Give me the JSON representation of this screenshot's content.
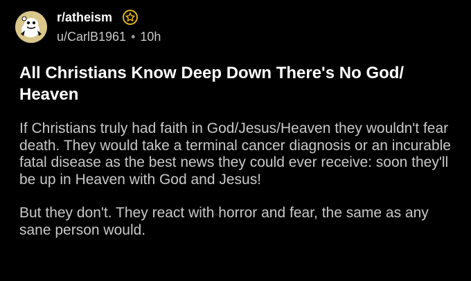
{
  "post": {
    "subreddit": "r/atheism",
    "author": "u/CarlB1961",
    "separator": "•",
    "time": "10h",
    "title": "All Christians Know Deep Down There's No God/ Heaven",
    "paragraphs": [
      "If Christians truly had faith in God/Jesus/Heaven they wouldn't fear death. They would take a terminal cancer diagnosis or an incurable fatal disease as the best news they could ever receive: soon they'll be up in Heaven with God and Jesus!",
      "But they don't. They react with horror and fear, the same as any sane person would."
    ]
  },
  "icons": {
    "avatar": "snoo-avatar-icon",
    "join": "star-badge-icon"
  },
  "colors": {
    "background": "#000000",
    "title": "#ffffff",
    "body": "#c9c9c9",
    "meta": "#c8c8c8",
    "badge": "#e6b422"
  }
}
